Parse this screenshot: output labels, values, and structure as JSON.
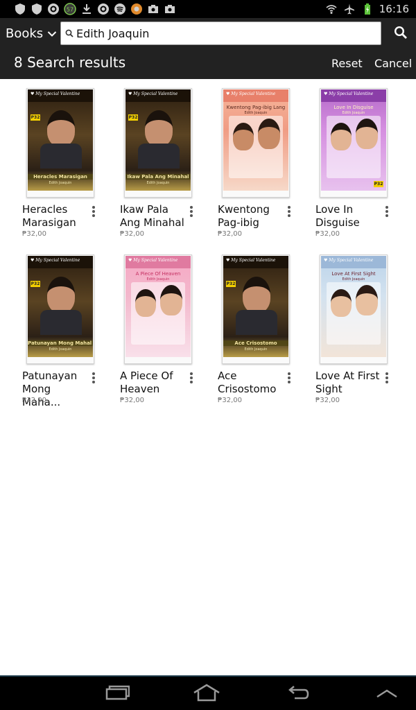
{
  "status_bar": {
    "time": "16:16",
    "battery": "charging",
    "notification_icons": [
      "shield-icon",
      "shield-icon",
      "app-icon",
      "badge-57-icon",
      "download-icon",
      "app-icon",
      "spotify-icon",
      "app-icon",
      "camera-icon",
      "camera-icon"
    ],
    "notification_badge": "57"
  },
  "action_bar": {
    "books_label": "Books",
    "search_value": "Edith Joaquin",
    "results_label": "8 Search results",
    "reset_label": "Reset",
    "cancel_label": "Cancel"
  },
  "books": [
    {
      "title": "Heracles Marasigan",
      "price": "₱32,00",
      "cover_title": "Heracles Marasigan",
      "cover_author": "Edith Joaquin",
      "cover_series": "My Special Valentine",
      "theme": "dark"
    },
    {
      "title": "Ikaw Pala Ang Minahal",
      "price": "₱32,00",
      "cover_title": "Ikaw Pala Ang Minahal",
      "cover_author": "Edith Joaquin",
      "cover_series": "My Special Valentine",
      "theme": "dark"
    },
    {
      "title": "Kwentong Pag-ibig",
      "price": "₱32,00",
      "cover_title": "Kwentong Pag-ibig Lang",
      "cover_author": "Edith Joaquin",
      "cover_series": "My Special Valentine",
      "theme": "peach"
    },
    {
      "title": "Love In Disguise",
      "price": "₱32,00",
      "cover_title": "Love In Disguise",
      "cover_author": "Edith Joaquin",
      "cover_series": "My Special Valentine",
      "theme": "purple"
    },
    {
      "title": "Patunayan Mong Maha...",
      "price": "₱32,00",
      "cover_title": "Patunayan Mong Mahal Mo Ako",
      "cover_author": "Edith Joaquin",
      "cover_series": "My Special Valentine",
      "theme": "dark"
    },
    {
      "title": "A Piece Of Heaven",
      "price": "₱32,00",
      "cover_title": "A Piece Of Heaven",
      "cover_author": "Edith Joaquin",
      "cover_series": "My Special Valentine",
      "theme": "pink"
    },
    {
      "title": "Ace Crisostomo",
      "price": "₱32,00",
      "cover_title": "Ace Crisostomo",
      "cover_author": "Edith Joaquin",
      "cover_series": "My Special Valentine",
      "theme": "dark"
    },
    {
      "title": "Love At First Sight",
      "price": "₱32,00",
      "cover_title": "Love At First Sight",
      "cover_author": "Edith Joaquin",
      "cover_series": "My Special Valentine",
      "theme": "blue"
    }
  ],
  "nav_bar": {
    "buttons": [
      "recent-apps-icon",
      "home-icon",
      "back-icon",
      "up-chevron-icon"
    ]
  }
}
